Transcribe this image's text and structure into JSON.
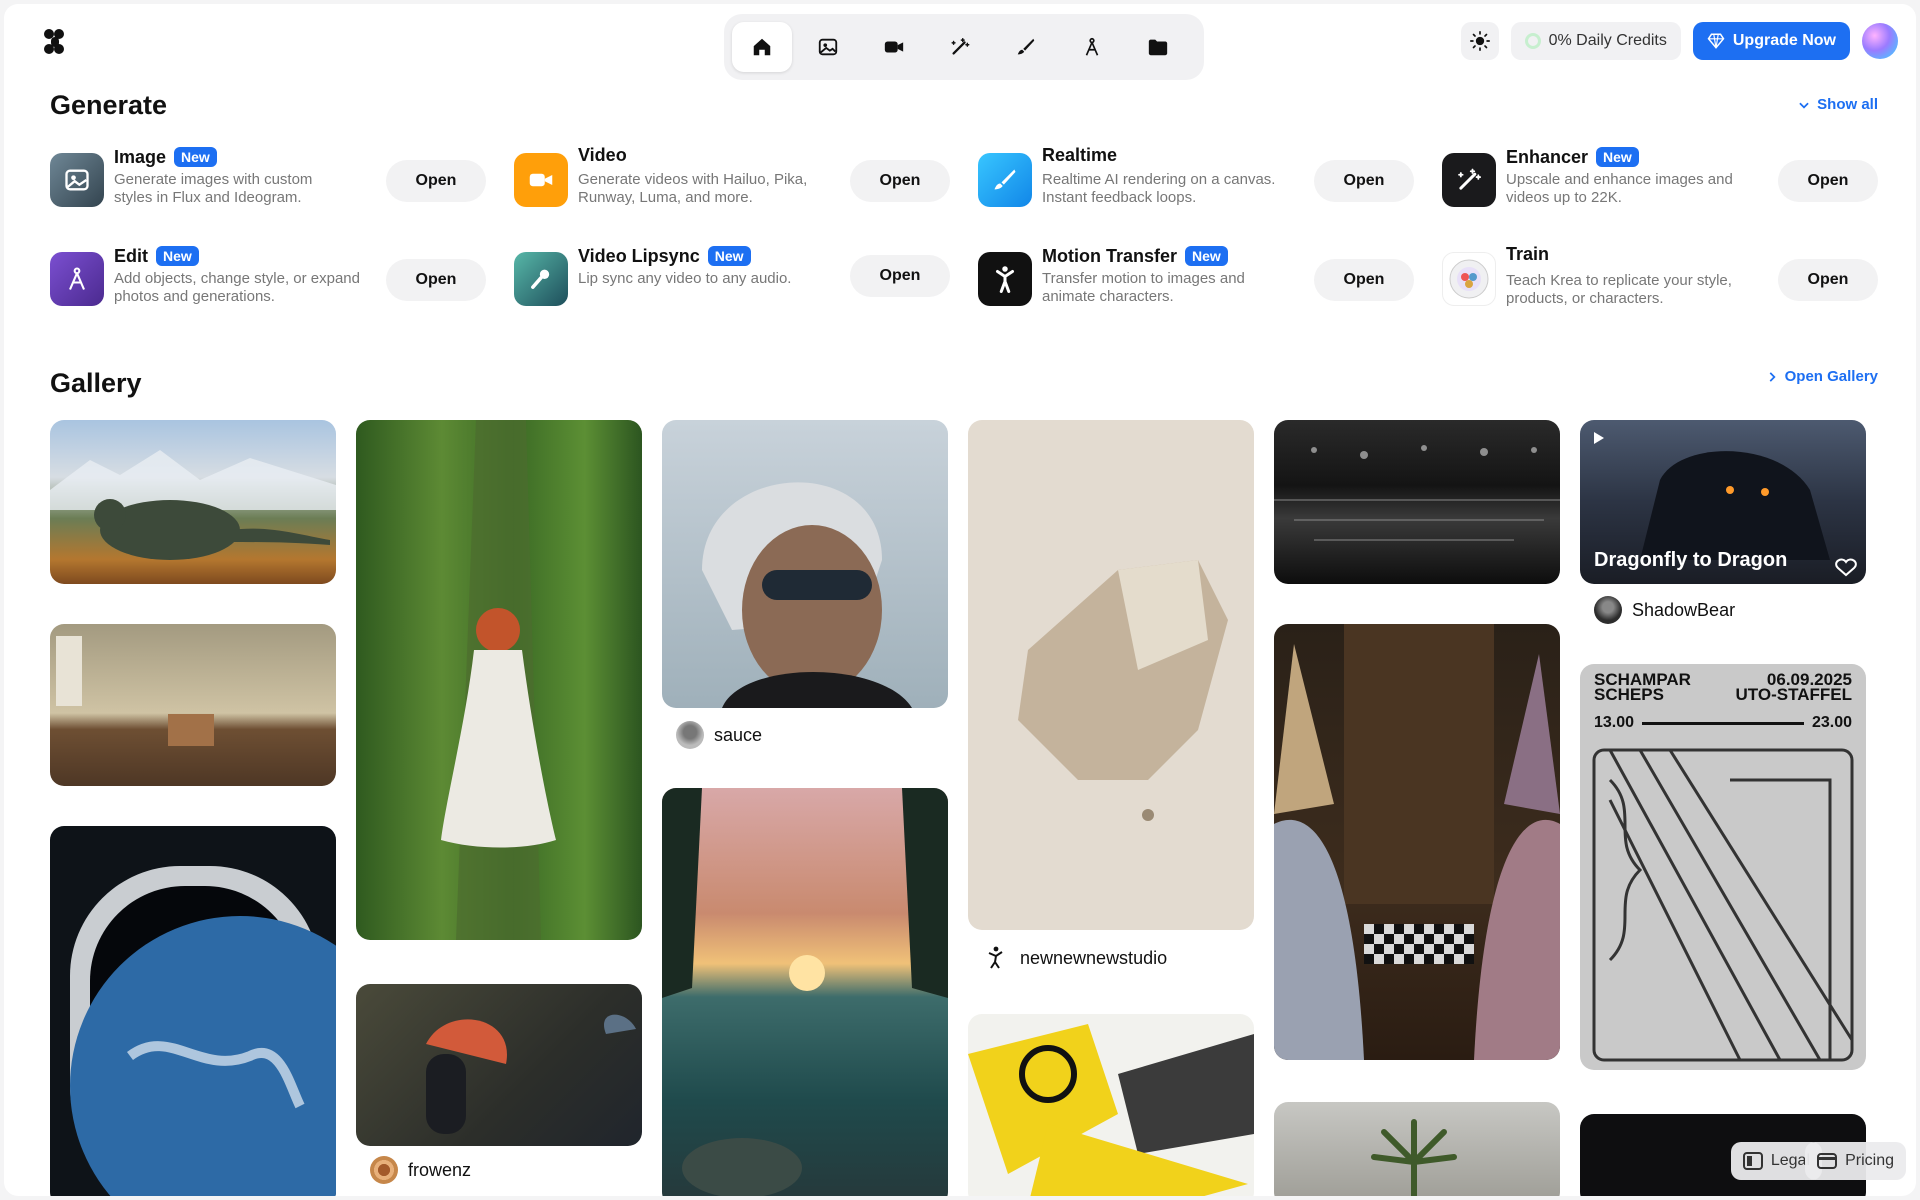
{
  "header": {
    "credits": "0% Daily Credits",
    "upgrade": "Upgrade Now",
    "nav": [
      "home-icon",
      "image-icon",
      "video-icon",
      "magic-wand-icon",
      "brush-icon",
      "edit-icon",
      "folder-icon"
    ]
  },
  "generate": {
    "title": "Generate",
    "show_all": "Show all",
    "open_label": "Open",
    "new_label": "New",
    "tools": [
      {
        "name": "Image",
        "badge": "New",
        "desc": "Generate images with custom styles in Flux and Ideogram.",
        "icon": "image-icon"
      },
      {
        "name": "Video",
        "badge": "",
        "desc": "Generate videos with Hailuo, Pika, Runway, Luma, and more.",
        "icon": "video-icon"
      },
      {
        "name": "Realtime",
        "badge": "",
        "desc": "Realtime AI rendering on a canvas. Instant feedback loops.",
        "icon": "brush-icon"
      },
      {
        "name": "Enhancer",
        "badge": "New",
        "desc": "Upscale and enhance images and videos up to 22K.",
        "icon": "magic-wand-icon"
      },
      {
        "name": "Edit",
        "badge": "New",
        "desc": "Add objects, change style, or expand photos and generations.",
        "icon": "edit-icon"
      },
      {
        "name": "Video Lipsync",
        "badge": "New",
        "desc": "Lip sync any video to any audio.",
        "icon": "microphone-icon"
      },
      {
        "name": "Motion Transfer",
        "badge": "New",
        "desc": "Transfer motion to images and animate characters.",
        "icon": "figure-icon"
      },
      {
        "name": "Train",
        "badge": "",
        "desc": "Teach Krea to replicate your style, products, or characters.",
        "icon": "train-icon"
      }
    ]
  },
  "gallery": {
    "title": "Gallery",
    "open": "Open Gallery",
    "credits": {
      "sauce": "sauce",
      "frowenz": "frowenz",
      "newnew": "newnewnewstudio",
      "shadow": "ShadowBear"
    },
    "dragon_title": "Dragonfly to Dragon",
    "poster": {
      "left_top": "SCHAMPAR",
      "left_bottom": "SCHEPS",
      "right_top": "06.09.2025",
      "right_bottom": "UTO-STAFFEL",
      "time_start": "13.00",
      "time_end": "23.00"
    }
  },
  "footer": {
    "legal": "Legal",
    "pricing": "Pricing"
  },
  "colors": {
    "accent": "#1d6ff2",
    "video_icon": "#ff9f0a",
    "realtime_icon": "#1aa7f0",
    "edit_icon": "#6a3fb5"
  }
}
